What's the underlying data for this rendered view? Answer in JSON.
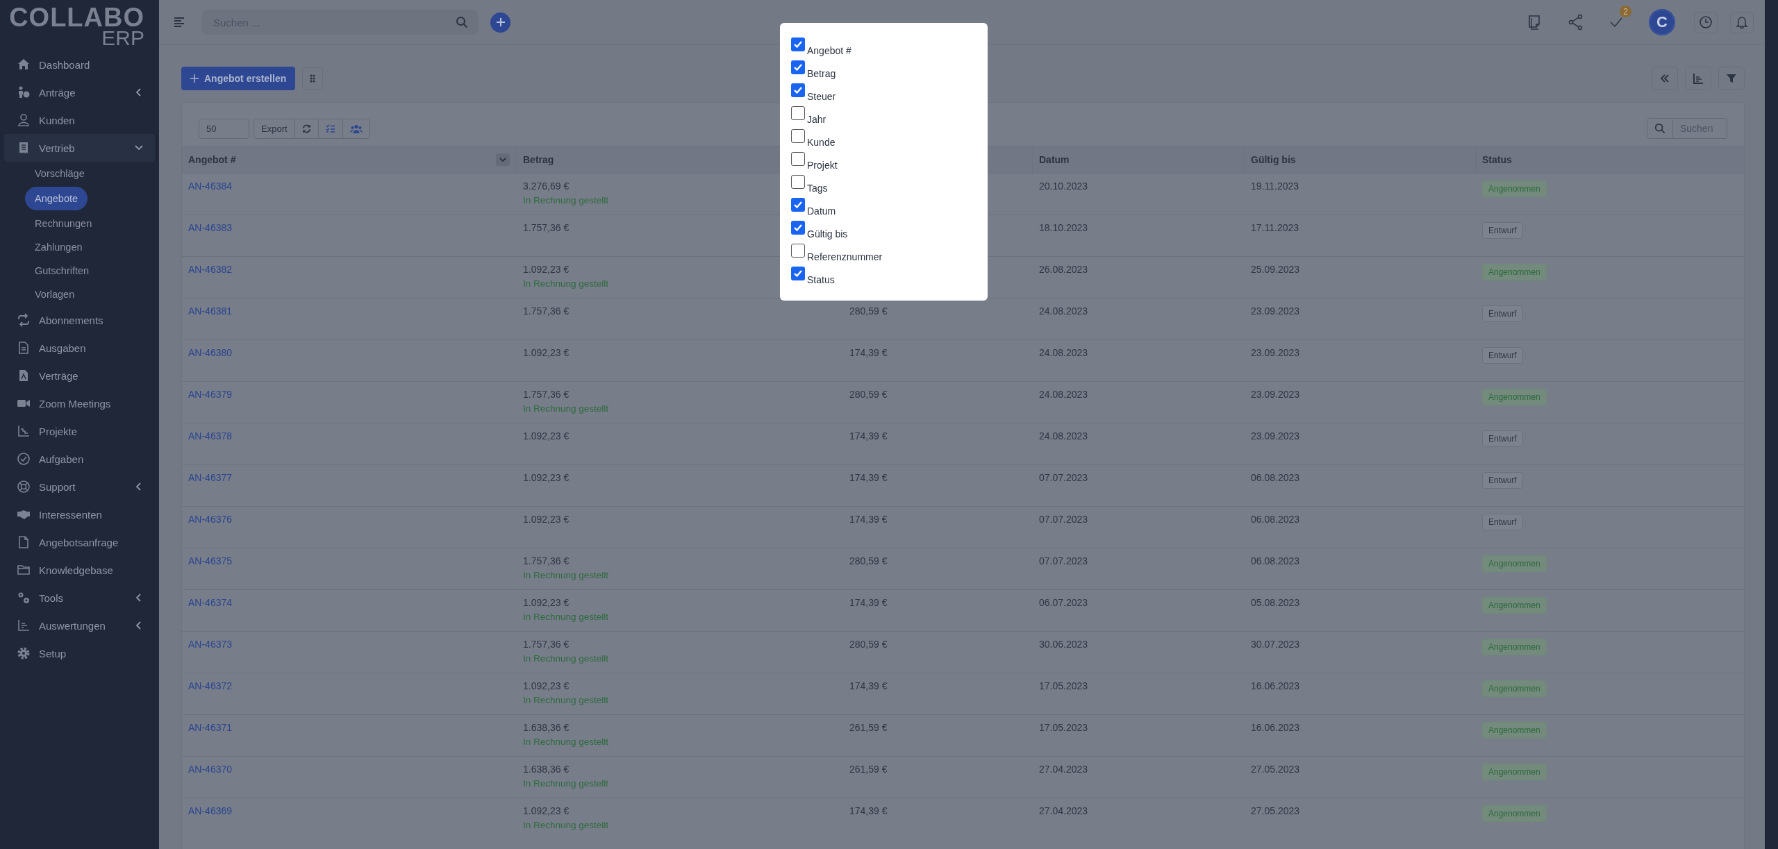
{
  "sidebar": {
    "logo": {
      "line1": "COLLABO",
      "line2": "ERP"
    },
    "items": [
      {
        "label": "Dashboard",
        "selected": false,
        "expandable": false
      },
      {
        "label": "Anträge",
        "selected": false,
        "expandable": true,
        "expanded": false
      },
      {
        "label": "Kunden",
        "selected": false,
        "expandable": false
      },
      {
        "label": "Vertrieb",
        "selected": true,
        "expandable": true,
        "expanded": true,
        "children": [
          {
            "label": "Vorschläge",
            "selected": false
          },
          {
            "label": "Angebote",
            "selected": true
          },
          {
            "label": "Rechnungen",
            "selected": false
          },
          {
            "label": "Zahlungen",
            "selected": false
          },
          {
            "label": "Gutschriften",
            "selected": false
          },
          {
            "label": "Vorlagen",
            "selected": false
          }
        ]
      },
      {
        "label": "Abonnements",
        "selected": false,
        "expandable": false
      },
      {
        "label": "Ausgaben",
        "selected": false,
        "expandable": false
      },
      {
        "label": "Verträge",
        "selected": false,
        "expandable": false
      },
      {
        "label": "Zoom Meetings",
        "selected": false,
        "expandable": false
      },
      {
        "label": "Projekte",
        "selected": false,
        "expandable": false
      },
      {
        "label": "Aufgaben",
        "selected": false,
        "expandable": false
      },
      {
        "label": "Support",
        "selected": false,
        "expandable": true,
        "expanded": false
      },
      {
        "label": "Interessenten",
        "selected": false,
        "expandable": false
      },
      {
        "label": "Angebotsanfrage",
        "selected": false,
        "expandable": false
      },
      {
        "label": "Knowledgebase",
        "selected": false,
        "expandable": false
      },
      {
        "label": "Tools",
        "selected": false,
        "expandable": true,
        "expanded": false
      },
      {
        "label": "Auswertungen",
        "selected": false,
        "expandable": true,
        "expanded": false
      },
      {
        "label": "Setup",
        "selected": false,
        "expandable": false
      }
    ]
  },
  "topbar": {
    "search": {
      "placeholder": "Suchen ..."
    },
    "tasks_badge": "2",
    "avatar_letter": "C"
  },
  "toolbar": {
    "create_button": "Angebot erstellen"
  },
  "table_controls": {
    "page_size": "50",
    "export_button": "Export",
    "search": {
      "placeholder": "Suchen"
    }
  },
  "table": {
    "columns": [
      {
        "label": "Angebot #",
        "menu": true
      },
      {
        "label": "Betrag"
      },
      {},
      {
        "label": "Datum"
      },
      {
        "label": "Gültig bis"
      },
      {
        "label": "Status"
      }
    ],
    "rows": [
      {
        "number": "AN-46384",
        "amount": "3.276,69 €",
        "note": "In Rechnung gestellt",
        "date": "20.10.2023",
        "valid_until": "19.11.2023",
        "status": {
          "text": "Angenommen",
          "kind": "accepted"
        }
      },
      {
        "number": "AN-46383",
        "amount": "1.757,36 €",
        "date": "18.10.2023",
        "valid_until": "17.11.2023",
        "status": {
          "text": "Entwurf",
          "kind": "draft"
        }
      },
      {
        "number": "AN-46382",
        "amount": "1.092,23 €",
        "note": "In Rechnung gestellt",
        "date": "26.08.2023",
        "valid_until": "25.09.2023",
        "status": {
          "text": "Angenommen",
          "kind": "accepted"
        }
      },
      {
        "number": "AN-46381",
        "amount": "1.757,36 €",
        "tax": "280,59 €",
        "date": "24.08.2023",
        "valid_until": "23.09.2023",
        "status": {
          "text": "Entwurf",
          "kind": "draft"
        }
      },
      {
        "number": "AN-46380",
        "amount": "1.092,23 €",
        "tax": "174,39 €",
        "date": "24.08.2023",
        "valid_until": "23.09.2023",
        "status": {
          "text": "Entwurf",
          "kind": "draft"
        }
      },
      {
        "number": "AN-46379",
        "amount": "1.757,36 €",
        "note": "In Rechnung gestellt",
        "tax": "280,59 €",
        "date": "24.08.2023",
        "valid_until": "23.09.2023",
        "status": {
          "text": "Angenommen",
          "kind": "accepted"
        }
      },
      {
        "number": "AN-46378",
        "amount": "1.092,23 €",
        "tax": "174,39 €",
        "date": "24.08.2023",
        "valid_until": "23.09.2023",
        "status": {
          "text": "Entwurf",
          "kind": "draft"
        }
      },
      {
        "number": "AN-46377",
        "amount": "1.092,23 €",
        "tax": "174,39 €",
        "date": "07.07.2023",
        "valid_until": "06.08.2023",
        "status": {
          "text": "Entwurf",
          "kind": "draft"
        }
      },
      {
        "number": "AN-46376",
        "amount": "1.092,23 €",
        "tax": "174,39 €",
        "date": "07.07.2023",
        "valid_until": "06.08.2023",
        "status": {
          "text": "Entwurf",
          "kind": "draft"
        }
      },
      {
        "number": "AN-46375",
        "amount": "1.757,36 €",
        "note": "In Rechnung gestellt",
        "tax": "280,59 €",
        "date": "07.07.2023",
        "valid_until": "06.08.2023",
        "status": {
          "text": "Angenommen",
          "kind": "accepted"
        }
      },
      {
        "number": "AN-46374",
        "amount": "1.092,23 €",
        "note": "In Rechnung gestellt",
        "tax": "174,39 €",
        "date": "06.07.2023",
        "valid_until": "05.08.2023",
        "status": {
          "text": "Angenommen",
          "kind": "accepted"
        }
      },
      {
        "number": "AN-46373",
        "amount": "1.757,36 €",
        "note": "In Rechnung gestellt",
        "tax": "280,59 €",
        "date": "30.06.2023",
        "valid_until": "30.07.2023",
        "status": {
          "text": "Angenommen",
          "kind": "accepted"
        }
      },
      {
        "number": "AN-46372",
        "amount": "1.092,23 €",
        "note": "In Rechnung gestellt",
        "tax": "174,39 €",
        "date": "17.05.2023",
        "valid_until": "16.06.2023",
        "status": {
          "text": "Angenommen",
          "kind": "accepted"
        }
      },
      {
        "number": "AN-46371",
        "amount": "1.638,36 €",
        "note": "In Rechnung gestellt",
        "tax": "261,59 €",
        "date": "17.05.2023",
        "valid_until": "16.06.2023",
        "status": {
          "text": "Angenommen",
          "kind": "accepted"
        }
      },
      {
        "number": "AN-46370",
        "amount": "1.638,36 €",
        "note": "In Rechnung gestellt",
        "tax": "261,59 €",
        "date": "27.04.2023",
        "valid_until": "27.05.2023",
        "status": {
          "text": "Angenommen",
          "kind": "accepted"
        }
      },
      {
        "number": "AN-46369",
        "amount": "1.092,23 €",
        "note": "In Rechnung gestellt",
        "tax": "174,39 €",
        "date": "27.04.2023",
        "valid_until": "27.05.2023",
        "status": {
          "text": "Angenommen",
          "kind": "accepted"
        }
      }
    ]
  },
  "column_picker": {
    "items": [
      {
        "label": "Angebot #",
        "checked": true
      },
      {
        "label": "Betrag",
        "checked": true
      },
      {
        "label": "Steuer",
        "checked": true
      },
      {
        "label": "Jahr",
        "checked": false
      },
      {
        "label": "Kunde",
        "checked": false
      },
      {
        "label": "Projekt",
        "checked": false
      },
      {
        "label": "Tags",
        "checked": false
      },
      {
        "label": "Datum",
        "checked": true
      },
      {
        "label": "Gültig bis",
        "checked": true
      },
      {
        "label": "Referenznummer",
        "checked": false
      },
      {
        "label": "Status",
        "checked": true
      }
    ]
  }
}
